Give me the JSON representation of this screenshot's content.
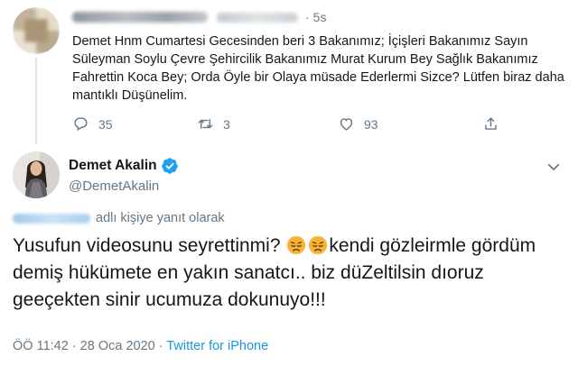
{
  "parent_tweet": {
    "time": "5s",
    "text": "Demet Hnm Cumartesi Gecesinden beri 3 Bakanımız; İçişleri Bakanımız Sayın Süleyman Soylu Çevre Şehircilik Bakanımız Murat Kurum Bey Sağlık Bakanımız Fahrettin Koca Bey; Orda Öyle bir Olaya müsade Ederlermi Sizce? Lütfen biraz daha mantıklı Düşünelim.",
    "replies": "35",
    "retweets": "3",
    "likes": "93",
    "icons": {
      "reply": "reply-icon",
      "retweet": "retweet-icon",
      "like": "heart-icon",
      "share": "share-icon"
    }
  },
  "main_tweet": {
    "display_name": "Demet Akalin",
    "handle": "@DemetAkalin",
    "replying_to": "adlı kişiye yanıt olarak",
    "text_part1": "Yusufun videosunu seyrettinmi? ",
    "text_part2": "kendi gözleirmle gördüm demiş hükümete en yakın sanatcı.. biz düZeltilsin dıoruz geeçekten sinir ucumuza dokunuyo!!!",
    "emojis": [
      "disappointed-face-emoji",
      "disappointed-face-emoji"
    ],
    "timestamp": "ÖÖ 11:42 · 28 Oca 2020 · ",
    "source": "Twitter for iPhone",
    "accent_color": "#1da1f2"
  }
}
